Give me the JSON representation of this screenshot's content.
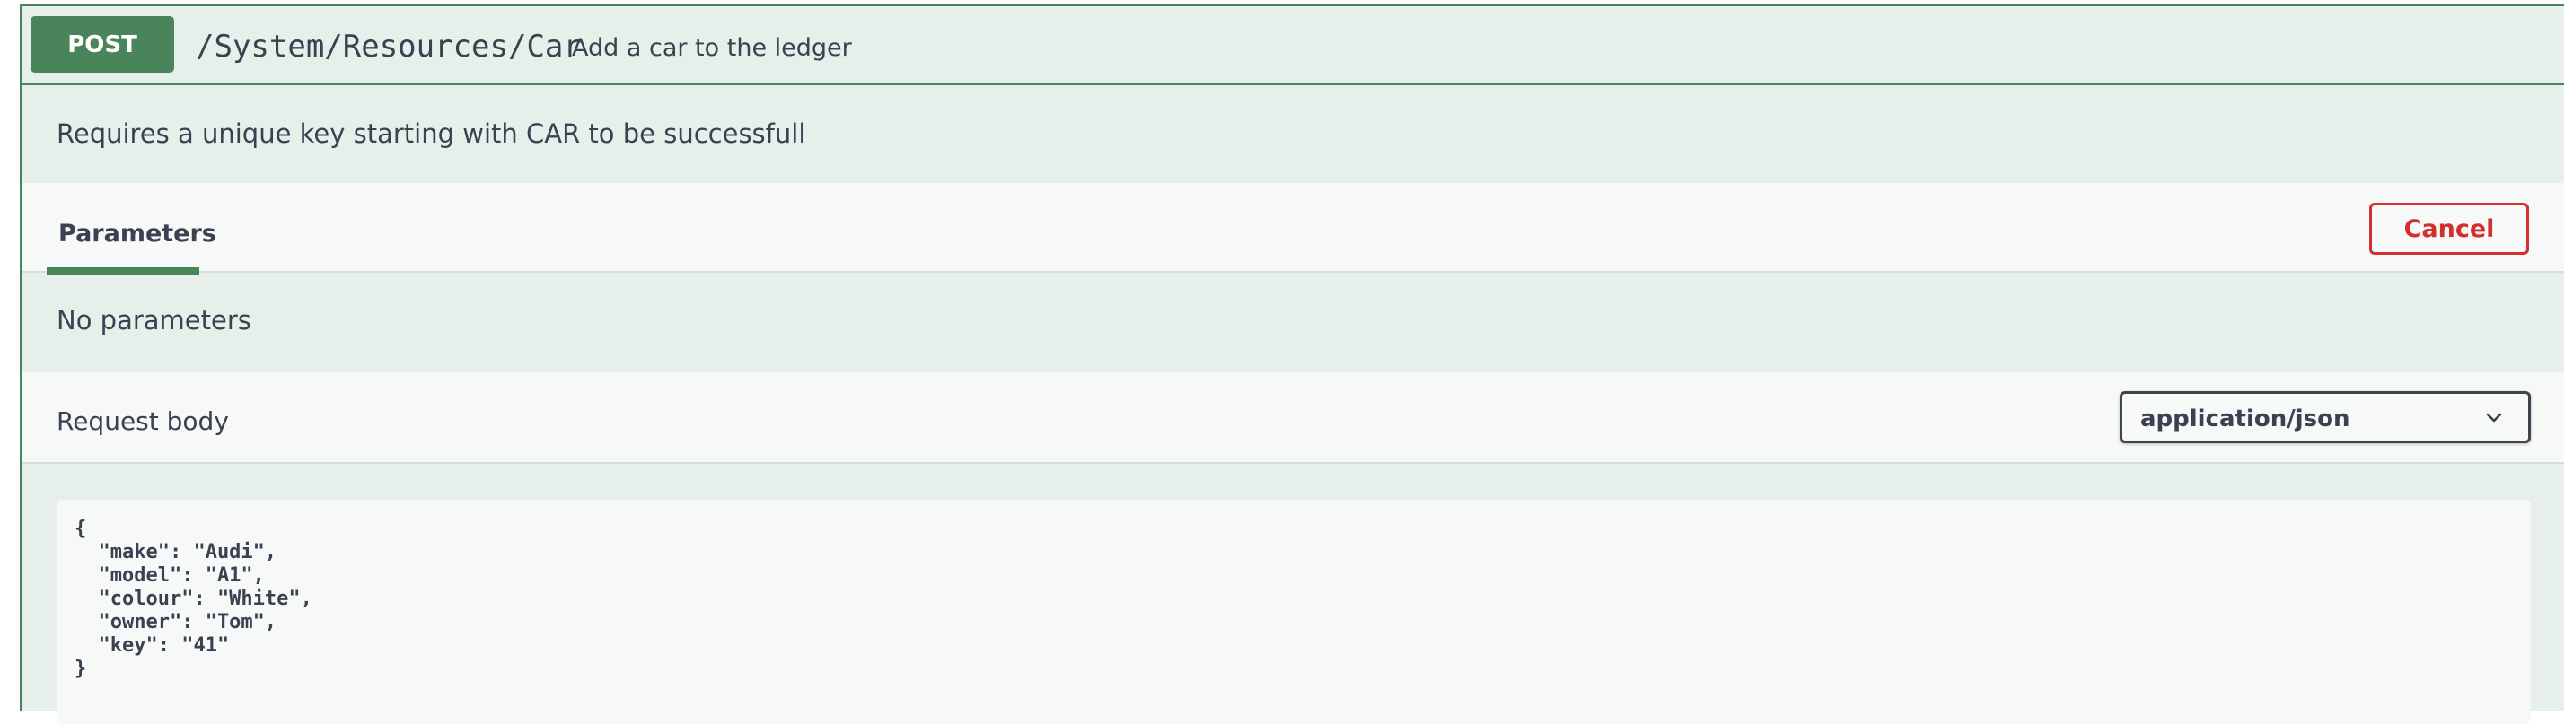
{
  "operation": {
    "method": "POST",
    "path": "/System/Resources/Car",
    "summary": "Add a car to the ledger",
    "description": "Requires a unique key starting with CAR to be successfull"
  },
  "parameters": {
    "tab_label": "Parameters",
    "cancel_label": "Cancel",
    "empty_text": "No parameters"
  },
  "request_body": {
    "label": "Request body",
    "content_type": "application/json",
    "content_type_icon": "chevron-down-icon",
    "body": "{\n  \"make\": \"Audi\",\n  \"model\": \"A1\",\n  \"colour\": \"White\",\n  \"owner\": \"Tom\",\n  \"key\": \"41\"\n}"
  },
  "colors": {
    "post_accent": "#49845a",
    "cancel_red": "#d32f2f",
    "block_background": "#e7efea",
    "text": "#3b4151"
  }
}
